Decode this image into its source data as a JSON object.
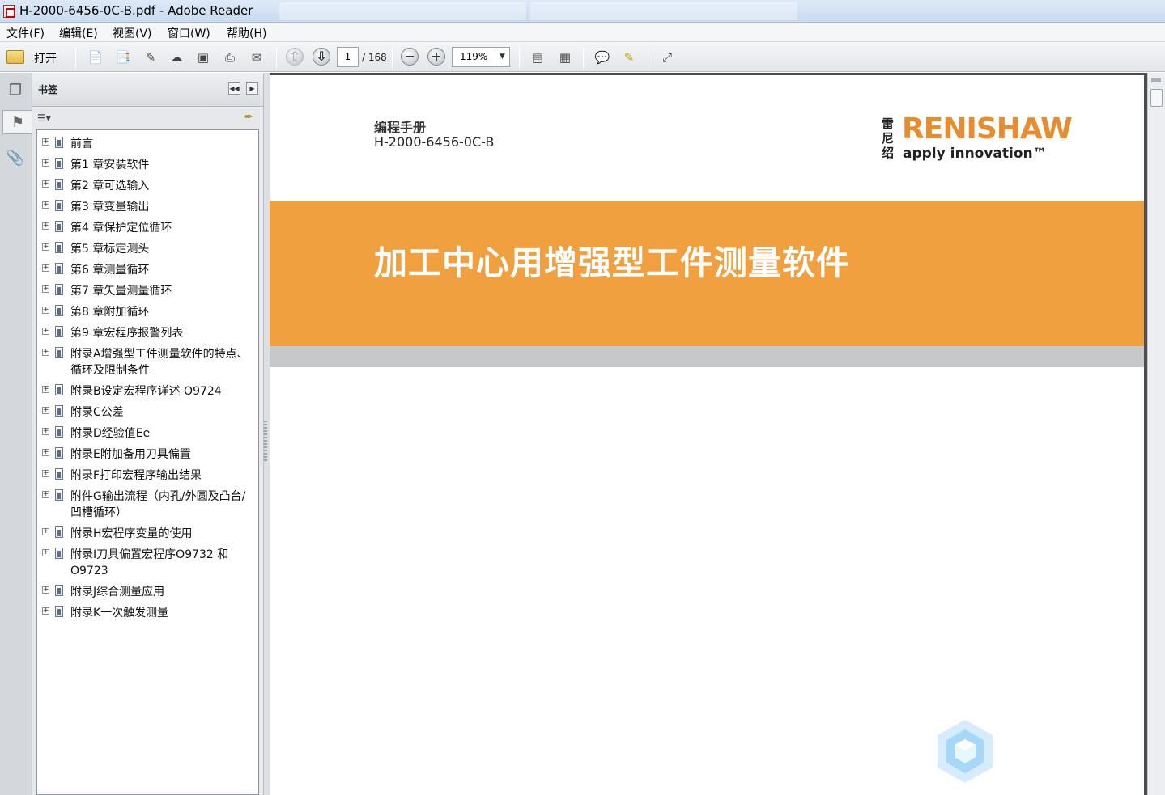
{
  "window": {
    "title": "H-2000-6456-0C-B.pdf - Adobe Reader"
  },
  "menu": [
    {
      "label": "文件(F)"
    },
    {
      "label": "编辑(E)"
    },
    {
      "label": "视图(V)"
    },
    {
      "label": "窗口(W)"
    },
    {
      "label": "帮助(H)"
    }
  ],
  "toolbar": {
    "open_label": "打开",
    "page_current": "1",
    "page_total": "/ 168",
    "zoom": "119%",
    "icons": [
      "create-pdf-icon",
      "export-icon",
      "sign-icon",
      "upload-icon",
      "save-icon",
      "print-icon",
      "email-icon",
      "prev-page-icon",
      "next-page-icon",
      "zoom-out-icon",
      "zoom-in-icon",
      "fit-page-icon",
      "fit-width-icon",
      "comment-icon",
      "highlight-icon",
      "fullscreen-icon"
    ]
  },
  "bookmarks": {
    "title": "书签",
    "items": [
      {
        "label": "前言"
      },
      {
        "label": "第1 章安装软件"
      },
      {
        "label": "第2 章可选输入"
      },
      {
        "label": "第3 章变量输出"
      },
      {
        "label": "第4 章保护定位循环"
      },
      {
        "label": "第5 章标定测头"
      },
      {
        "label": "第6 章测量循环"
      },
      {
        "label": "第7 章矢量测量循环"
      },
      {
        "label": "第8 章附加循环"
      },
      {
        "label": "第9 章宏程序报警列表"
      },
      {
        "label": "附录A增强型工件测量软件的特点、循环及限制条件"
      },
      {
        "label": "附录B设定宏程序详述 O9724"
      },
      {
        "label": "附录C公差"
      },
      {
        "label": "附录D经验值Ee"
      },
      {
        "label": "附录E附加备用刀具偏置"
      },
      {
        "label": "附录F打印宏程序输出结果"
      },
      {
        "label": "附件G输出流程（内孔/外圆及凸台/凹槽循环）"
      },
      {
        "label": "附录H宏程序变量的使用"
      },
      {
        "label": "附录I刀具偏置宏程序O9732 和O9723"
      },
      {
        "label": "附录J综合测量应用"
      },
      {
        "label": "附录K一次触发测量"
      }
    ]
  },
  "document": {
    "manual_label": "编程手册",
    "doc_number": "H-2000-6456-0C-B",
    "logo_cn": "雷尼绍",
    "logo_brand": "RENISHAW",
    "logo_tagline": "apply innovation™",
    "title": "加工中心用增强型工件测量软件",
    "band_color": "#f0a03e",
    "brand_color": "#e78c2f"
  }
}
